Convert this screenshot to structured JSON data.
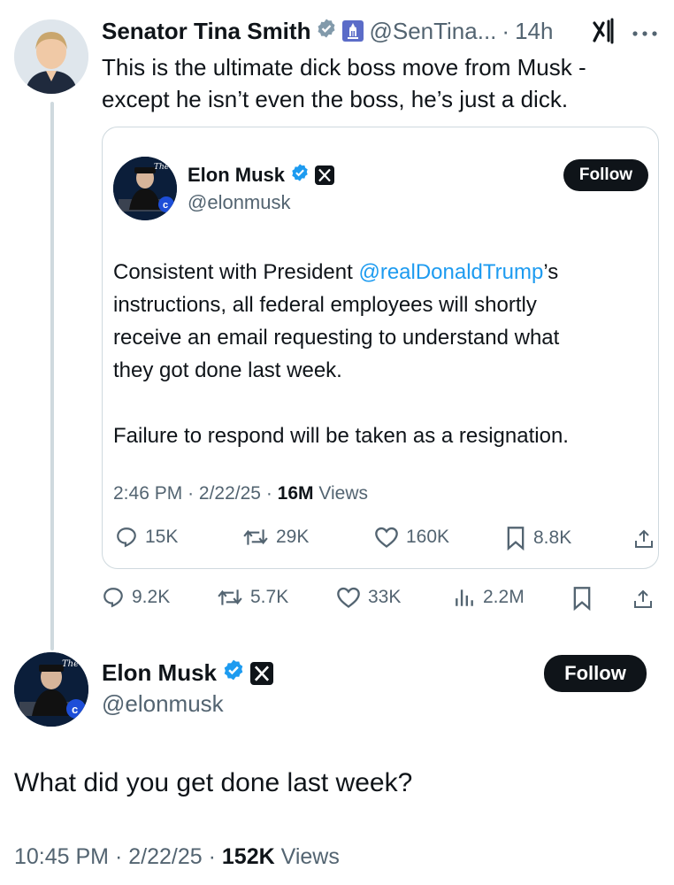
{
  "main_tweet": {
    "author_name": "Senator Tina Smith",
    "handle": "@SenTina...",
    "separator": "·",
    "time_ago": "14h",
    "text_line1": "This is the ultimate dick boss move from Musk -",
    "text_line2": "except he isn’t even the boss, he’s just a dick.",
    "actions": {
      "replies": "9.2K",
      "reposts": "5.7K",
      "likes": "33K",
      "views": "2.2M"
    }
  },
  "quoted_tweet": {
    "author_name": "Elon Musk",
    "handle": "@elonmusk",
    "follow_label": "Follow",
    "text": {
      "line1_prefix": "Consistent with President ",
      "line1_mention": "@realDonaldTrump",
      "line1_suffix": "’s",
      "line2": "instructions, all federal employees will shortly",
      "line3": "receive an email requesting to understand what",
      "line4": "they got done last week.",
      "line5": "Failure to respond will be taken as a resignation."
    },
    "meta": {
      "time": "2:46 PM",
      "date": "2/22/25",
      "views_count": "16M",
      "views_label": "Views",
      "dot": "·"
    },
    "actions": {
      "replies": "15K",
      "reposts": "29K",
      "likes": "160K",
      "bookmarks": "8.8K"
    }
  },
  "reply_tweet": {
    "author_name": "Elon Musk",
    "handle": "@elonmusk",
    "follow_label": "Follow",
    "text": "What did you get done last week?",
    "meta": {
      "time": "10:45 PM",
      "date": "2/22/25",
      "views_count": "152K",
      "views_label": "Views",
      "dot": "·"
    }
  },
  "colors": {
    "verified_blue": "#1d9bf0",
    "text": "#0f1419",
    "muted": "#536471",
    "border": "#cfd9de"
  },
  "icons": [
    "verified-icon",
    "government-badge-icon",
    "grok-icon",
    "more-icon",
    "x-logo-icon",
    "reply-icon",
    "repost-icon",
    "like-icon",
    "views-icon",
    "bookmark-icon",
    "share-icon"
  ]
}
